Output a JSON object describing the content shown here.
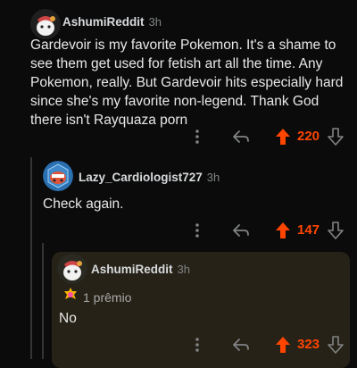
{
  "comments": [
    {
      "username": "AshumiReddit",
      "time": "3h",
      "body": "Gardevoir is my favorite Pokemon. It's a shame to see them get used for fetish art all the time. Any Pokemon, really. But Gardevoir hits especially hard since she's my favorite non-legend. Thank God there isn't Rayquaza porn",
      "score": "220"
    },
    {
      "username": "Lazy_Cardiologist727",
      "time": "3h",
      "body": "Check again.",
      "score": "147"
    },
    {
      "username": "AshumiReddit",
      "time": "3h",
      "award": "1 prêmio",
      "body": "No",
      "score": "323"
    }
  ],
  "icons": [
    "more-options-icon",
    "reply-icon",
    "upvote-icon",
    "downvote-icon",
    "award-icon",
    "avatar-icon"
  ],
  "colors": {
    "upvote": "#ff4500",
    "background": "#0b0b0b",
    "highlight": "#262217"
  }
}
